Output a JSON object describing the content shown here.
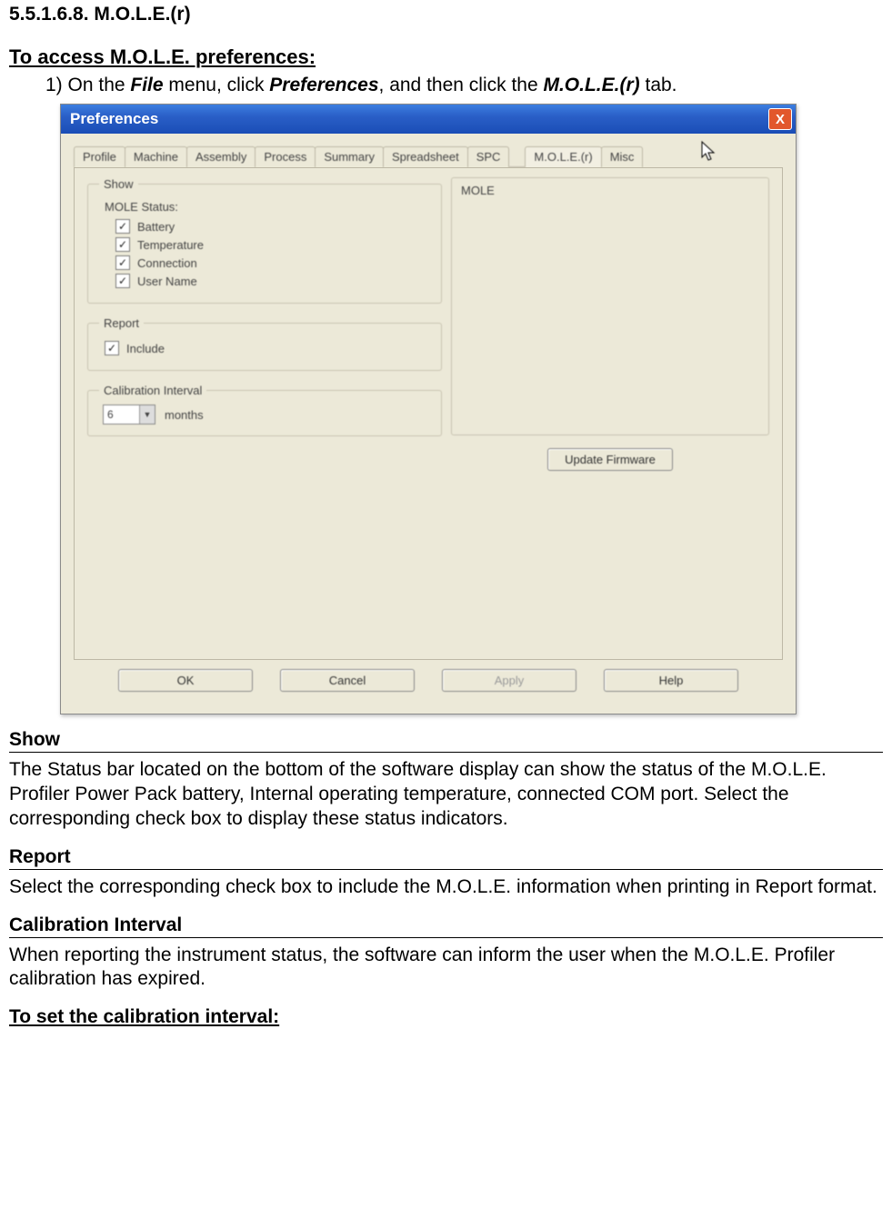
{
  "doc": {
    "section_number": "5.5.1.6.8. M.O.L.E.(r)",
    "access_heading": "To access M.O.L.E. preferences:",
    "step_prefix": "1) On the ",
    "step_mid1": "File",
    "step_mid2": " menu, click ",
    "step_mid3": "Preferences",
    "step_mid4": ", and then click the ",
    "step_mid5": "M.O.L.E.(r)",
    "step_mid6": " tab.",
    "show_heading": "Show",
    "show_para": "The Status bar located on the bottom of the software display can show the status of the M.O.L.E. Profiler Power Pack battery,   Internal operating temperature, connected COM port. Select the corresponding check box to display these status indicators.",
    "report_heading": "Report",
    "report_para": "Select the corresponding check box to include the M.O.L.E. information when printing in Report format.",
    "cal_heading": "Calibration Interval",
    "cal_para": "When reporting the instrument status, the software can inform the user when the M.O.L.E. Profiler calibration has expired.",
    "set_cal_heading": "To set the calibration interval:"
  },
  "dialog": {
    "title": "Preferences",
    "close_glyph": "X",
    "tabs": [
      "Profile",
      "Machine",
      "Assembly",
      "Process",
      "Summary",
      "Spreadsheet",
      "SPC",
      "M.O.L.E.(r)",
      "Misc"
    ],
    "active_tab_index": 7,
    "show_group_label": "Show",
    "mole_status_label": "MOLE Status:",
    "checks": {
      "battery": "Battery",
      "temperature": "Temperature",
      "connection": "Connection",
      "username": "User Name"
    },
    "report_group_label": "Report",
    "report_check": "Include",
    "cal_group_label": "Calibration Interval",
    "cal_value": "6",
    "cal_unit": "months",
    "mole_group_label": "MOLE",
    "update_firmware_btn": "Update Firmware",
    "buttons": {
      "ok": "OK",
      "cancel": "Cancel",
      "apply": "Apply",
      "help": "Help"
    }
  }
}
